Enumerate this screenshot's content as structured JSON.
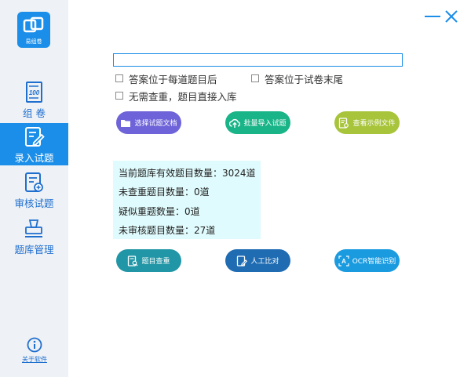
{
  "app": {
    "logo_text": "易组卷"
  },
  "sidebar": {
    "items": [
      {
        "label": "组 卷",
        "icon": "paper-100-icon",
        "active": false
      },
      {
        "label": "录入试题",
        "icon": "edit-document-icon",
        "active": true
      },
      {
        "label": "审核试题",
        "icon": "review-list-icon",
        "active": false
      },
      {
        "label": "题库管理",
        "icon": "stamp-icon",
        "active": false
      }
    ],
    "about_label": "关于软件"
  },
  "window": {
    "minimize_icon": "minimize-icon",
    "close_icon": "close-icon"
  },
  "main": {
    "file_path": {
      "value": "",
      "placeholder": ""
    },
    "options": [
      {
        "label": "答案位于每道题目后",
        "checked": false
      },
      {
        "label": "答案位于试卷末尾",
        "checked": false
      },
      {
        "label": "无需查重，题目直接入库",
        "checked": false
      }
    ],
    "buttons_row1": [
      {
        "label": "选择试题文档",
        "icon": "folder-icon",
        "color": "#6e63d9"
      },
      {
        "label": "批量导入试题",
        "icon": "cloud-upload-icon",
        "color": "#19b487"
      },
      {
        "label": "查看示例文件",
        "icon": "view-file-icon",
        "color": "#a7c43a"
      }
    ],
    "stats": [
      "当前题库有效题目数量：3024道",
      "未查重题目数量：0道",
      "疑似重题数量：0道",
      "未审核题目数量：27道"
    ],
    "buttons_row2": [
      {
        "label": "题目查重",
        "icon": "check-duplicate-icon",
        "color": "#2196a6"
      },
      {
        "label": "人工比对",
        "icon": "manual-compare-icon",
        "color": "#1f6cb3"
      },
      {
        "label": "OCR智能识别",
        "icon": "ocr-icon",
        "color": "#1a9be0"
      }
    ]
  },
  "colors": {
    "accent": "#1a8ee8",
    "sidebar_bg": "#eef1f5",
    "stats_bg": "#e0fbfd"
  }
}
